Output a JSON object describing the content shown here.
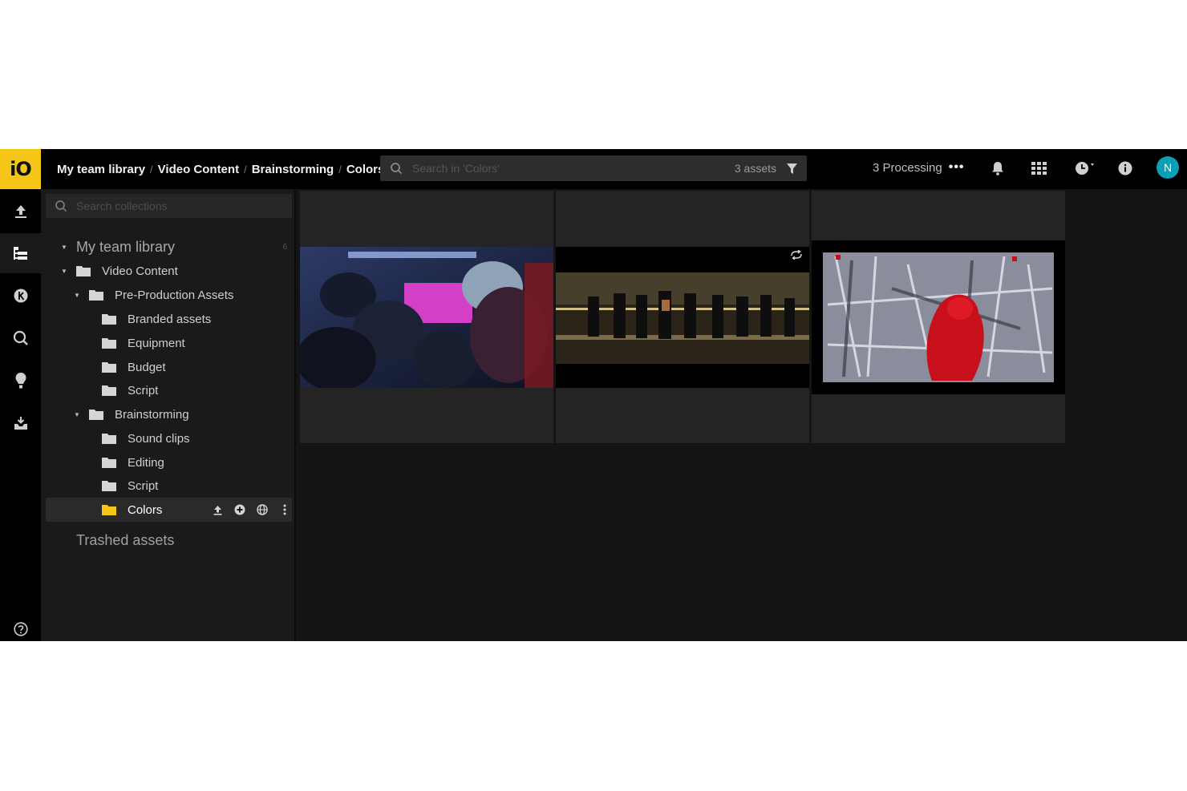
{
  "app": {
    "logo_text": "iO",
    "accent": "#f5c518"
  },
  "breadcrumb": [
    "My team library",
    "Video Content",
    "Brainstorming",
    "Colors"
  ],
  "search": {
    "placeholder": "Search in 'Colors'",
    "asset_count": "3 assets"
  },
  "processing": {
    "label": "3 Processing",
    "more": "•••"
  },
  "user": {
    "initial": "N",
    "color": "#0a9fb5"
  },
  "rail": [
    "upload-icon",
    "collections-icon",
    "keywords-icon",
    "search-icon",
    "lightbulb-icon",
    "download-tray-icon",
    "help-icon"
  ],
  "collections": {
    "search_placeholder": "Search collections",
    "root": {
      "label": "My team library",
      "count": "6"
    },
    "items": [
      {
        "label": "Video Content"
      },
      {
        "label": "Pre-Production Assets"
      },
      {
        "label": "Branded assets"
      },
      {
        "label": "Equipment"
      },
      {
        "label": "Budget"
      },
      {
        "label": "Script"
      },
      {
        "label": "Brainstorming"
      },
      {
        "label": "Sound clips"
      },
      {
        "label": "Editing"
      },
      {
        "label": "Script"
      },
      {
        "label": "Colors"
      }
    ],
    "trashed": "Trashed assets"
  },
  "assets": [
    {
      "kind": "video-thumbnail",
      "scene": "crowd in neon room"
    },
    {
      "kind": "video-thumbnail",
      "scene": "dancers on stage",
      "badge": "loop-icon"
    },
    {
      "kind": "video-thumbnail",
      "scene": "red hooded figure in mirrored room"
    }
  ]
}
